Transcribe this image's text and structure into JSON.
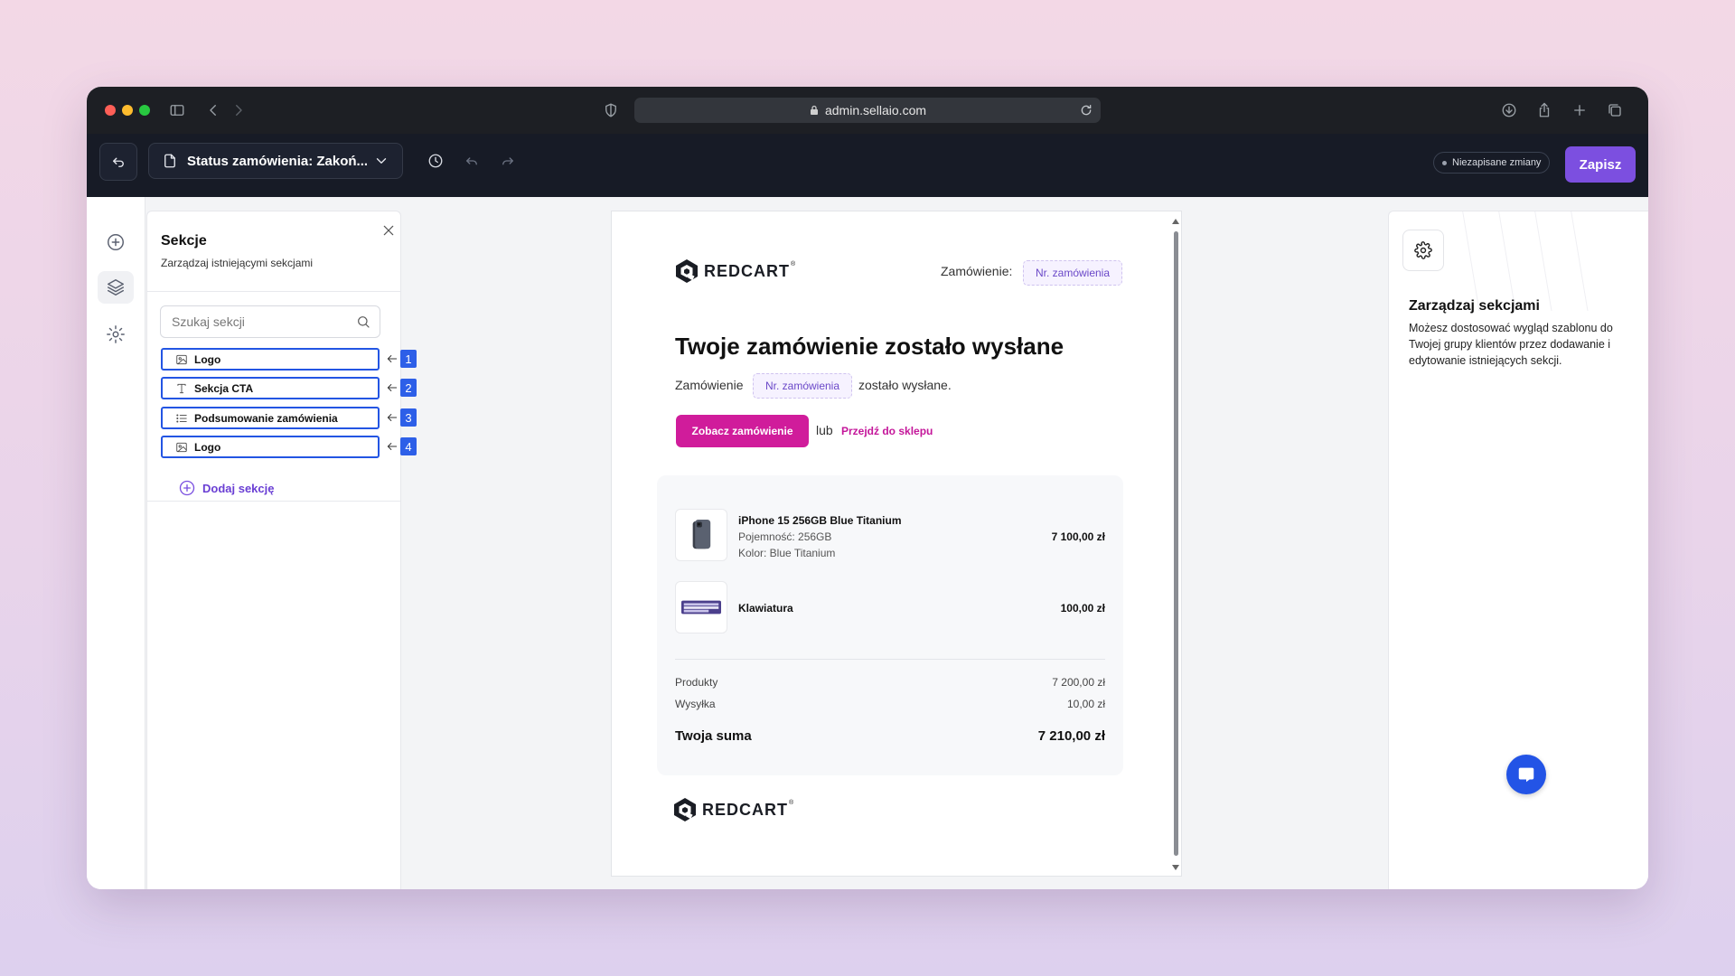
{
  "browser": {
    "url": "admin.sellaio.com"
  },
  "toolbar": {
    "status_label": "Status zamówienia: Zakoń...",
    "unsaved_label": "Niezapisane zmiany",
    "save_label": "Zapisz"
  },
  "sections_panel": {
    "title": "Sekcje",
    "subtitle": "Zarządzaj istniejącymi sekcjami",
    "search_placeholder": "Szukaj sekcji",
    "items": [
      {
        "label": "Logo",
        "icon": "image-icon",
        "badge": "1"
      },
      {
        "label": "Sekcja CTA",
        "icon": "text-icon",
        "badge": "2"
      },
      {
        "label": "Podsumowanie zamówienia",
        "icon": "list-icon",
        "badge": "3"
      },
      {
        "label": "Logo",
        "icon": "image-icon",
        "badge": "4"
      }
    ],
    "add_label": "Dodaj sekcję"
  },
  "email": {
    "brand": "REDCART",
    "order_label": "Zamówienie:",
    "order_chip": "Nr. zamówienia",
    "headline": "Twoje zamówienie zostało wysłane",
    "line_prefix": "Zamówienie",
    "line_chip": "Nr. zamówienia",
    "line_suffix": "zostało wysłane.",
    "cta_label": "Zobacz zamówienie",
    "or_label": "lub",
    "shop_link": "Przejdź do sklepu",
    "products": [
      {
        "name": "iPhone 15 256GB Blue Titanium",
        "meta": [
          "Pojemność: 256GB",
          "Kolor: Blue Titanium"
        ],
        "price": "7 100,00 zł"
      },
      {
        "name": "Klawiatura",
        "meta": [],
        "price": "100,00 zł"
      }
    ],
    "totals": {
      "products_label": "Produkty",
      "products_value": "7 200,00 zł",
      "shipping_label": "Wysyłka",
      "shipping_value": "10,00 zł",
      "total_label": "Twoja suma",
      "total_value": "7 210,00 zł"
    }
  },
  "right_panel": {
    "title": "Zarządzaj sekcjami",
    "description": "Możesz dostosować wygląd szablonu do Twojej grupy klientów przez dodawanie i edytowanie istniejących sekcji."
  },
  "colors": {
    "accent": "#7c4fe0",
    "cta": "#d01c9b",
    "highlight": "#2355e3"
  }
}
